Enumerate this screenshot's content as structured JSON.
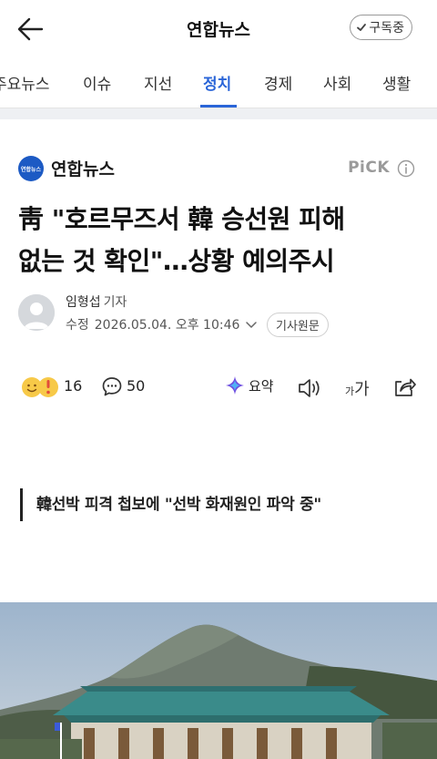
{
  "header": {
    "press_title": "연합뉴스",
    "subscribe_label": "구독중"
  },
  "tabs": [
    {
      "label": "주요뉴스",
      "active": false
    },
    {
      "label": "이슈",
      "active": false
    },
    {
      "label": "지선",
      "active": false
    },
    {
      "label": "정치",
      "active": true
    },
    {
      "label": "경제",
      "active": false
    },
    {
      "label": "사회",
      "active": false
    },
    {
      "label": "생활",
      "active": false
    }
  ],
  "article": {
    "press_name": "연합뉴스",
    "press_logo_text": "연합뉴스",
    "pick_label": "PiCK",
    "headline_line1": "靑 \"호르무즈서 韓 승선원 피해",
    "headline_line2": "없는 것 확인\"…상황 예의주시",
    "reporter": "임형섭",
    "reporter_role": "기자",
    "date_prefix": "수정",
    "date": "2026.05.04. 오후 10:46",
    "original_button": "기사원문",
    "subheading": "韓선박 피격 첩보에 \"선박 화재원인 파악 중\""
  },
  "actions": {
    "reaction_count": "16",
    "comment_count": "50",
    "summary_label": "요약",
    "font_small": "가",
    "font_large": "가"
  },
  "colors": {
    "accent": "#2a65d8",
    "press_logo": "#1c5ac4"
  }
}
